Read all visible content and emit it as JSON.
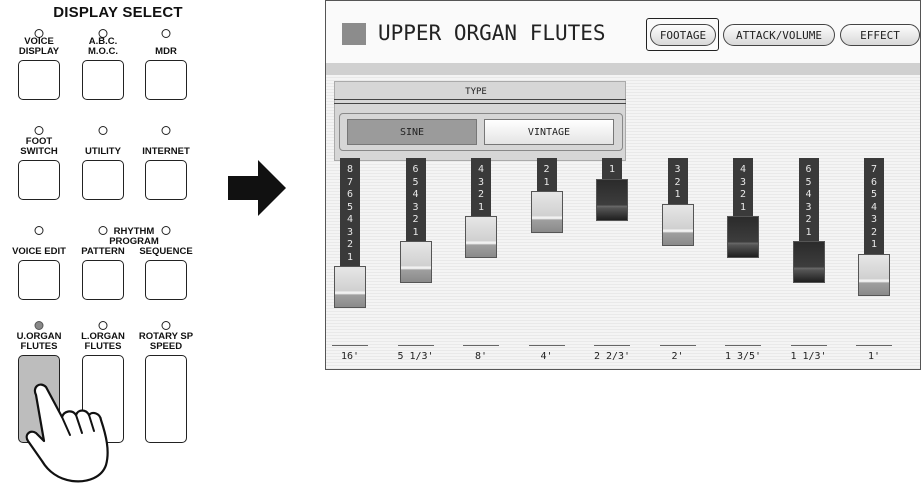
{
  "panel": {
    "title": "DISPLAY SELECT",
    "labels": {
      "voice_display": "VOICE\nDISPLAY",
      "abc_moc": "A.B.C.\nM.O.C.",
      "mdr": "MDR",
      "foot_switch": "FOOT\nSWITCH",
      "utility": "UTILITY",
      "internet": "INTERNET",
      "voice_edit": "VOICE EDIT",
      "rhythm_program": "RHYTHM\nPROGRAM",
      "pattern": "PATTERN",
      "sequence": "SEQUENCE",
      "u_organ_flutes": "U.ORGAN\nFLUTES",
      "l_organ_flutes": "L.ORGAN\nFLUTES",
      "rotary_sp_speed": "ROTARY SP\nSPEED"
    },
    "lit_led": "u_organ_flutes",
    "pressed_button": "u_organ_flutes"
  },
  "screen": {
    "title": "UPPER ORGAN FLUTES",
    "tabs": [
      "FOOTAGE",
      "ATTACK/VOLUME",
      "EFFECT"
    ],
    "active_tab": "FOOTAGE",
    "type_label": "TYPE",
    "type_options": [
      "SINE",
      "VINTAGE"
    ],
    "selected_type": "SINE",
    "footages": [
      {
        "label": "16'",
        "level": 8,
        "knob": "light"
      },
      {
        "label": "5 1/3'",
        "level": 6,
        "knob": "light"
      },
      {
        "label": "8'",
        "level": 4,
        "knob": "light"
      },
      {
        "label": "4'",
        "level": 2,
        "knob": "light"
      },
      {
        "label": "2 2/3'",
        "level": 1,
        "knob": "dark"
      },
      {
        "label": "2'",
        "level": 3,
        "knob": "light"
      },
      {
        "label": "1 3/5'",
        "level": 4,
        "knob": "dark"
      },
      {
        "label": "1 1/3'",
        "level": 6,
        "knob": "dark"
      },
      {
        "label": "1'",
        "level": 7,
        "knob": "light"
      }
    ]
  },
  "colors": {
    "selected_type_bg": "#9b9b9b",
    "bar_color": "#3a3a3a",
    "header_square": "#8c8c8c"
  }
}
